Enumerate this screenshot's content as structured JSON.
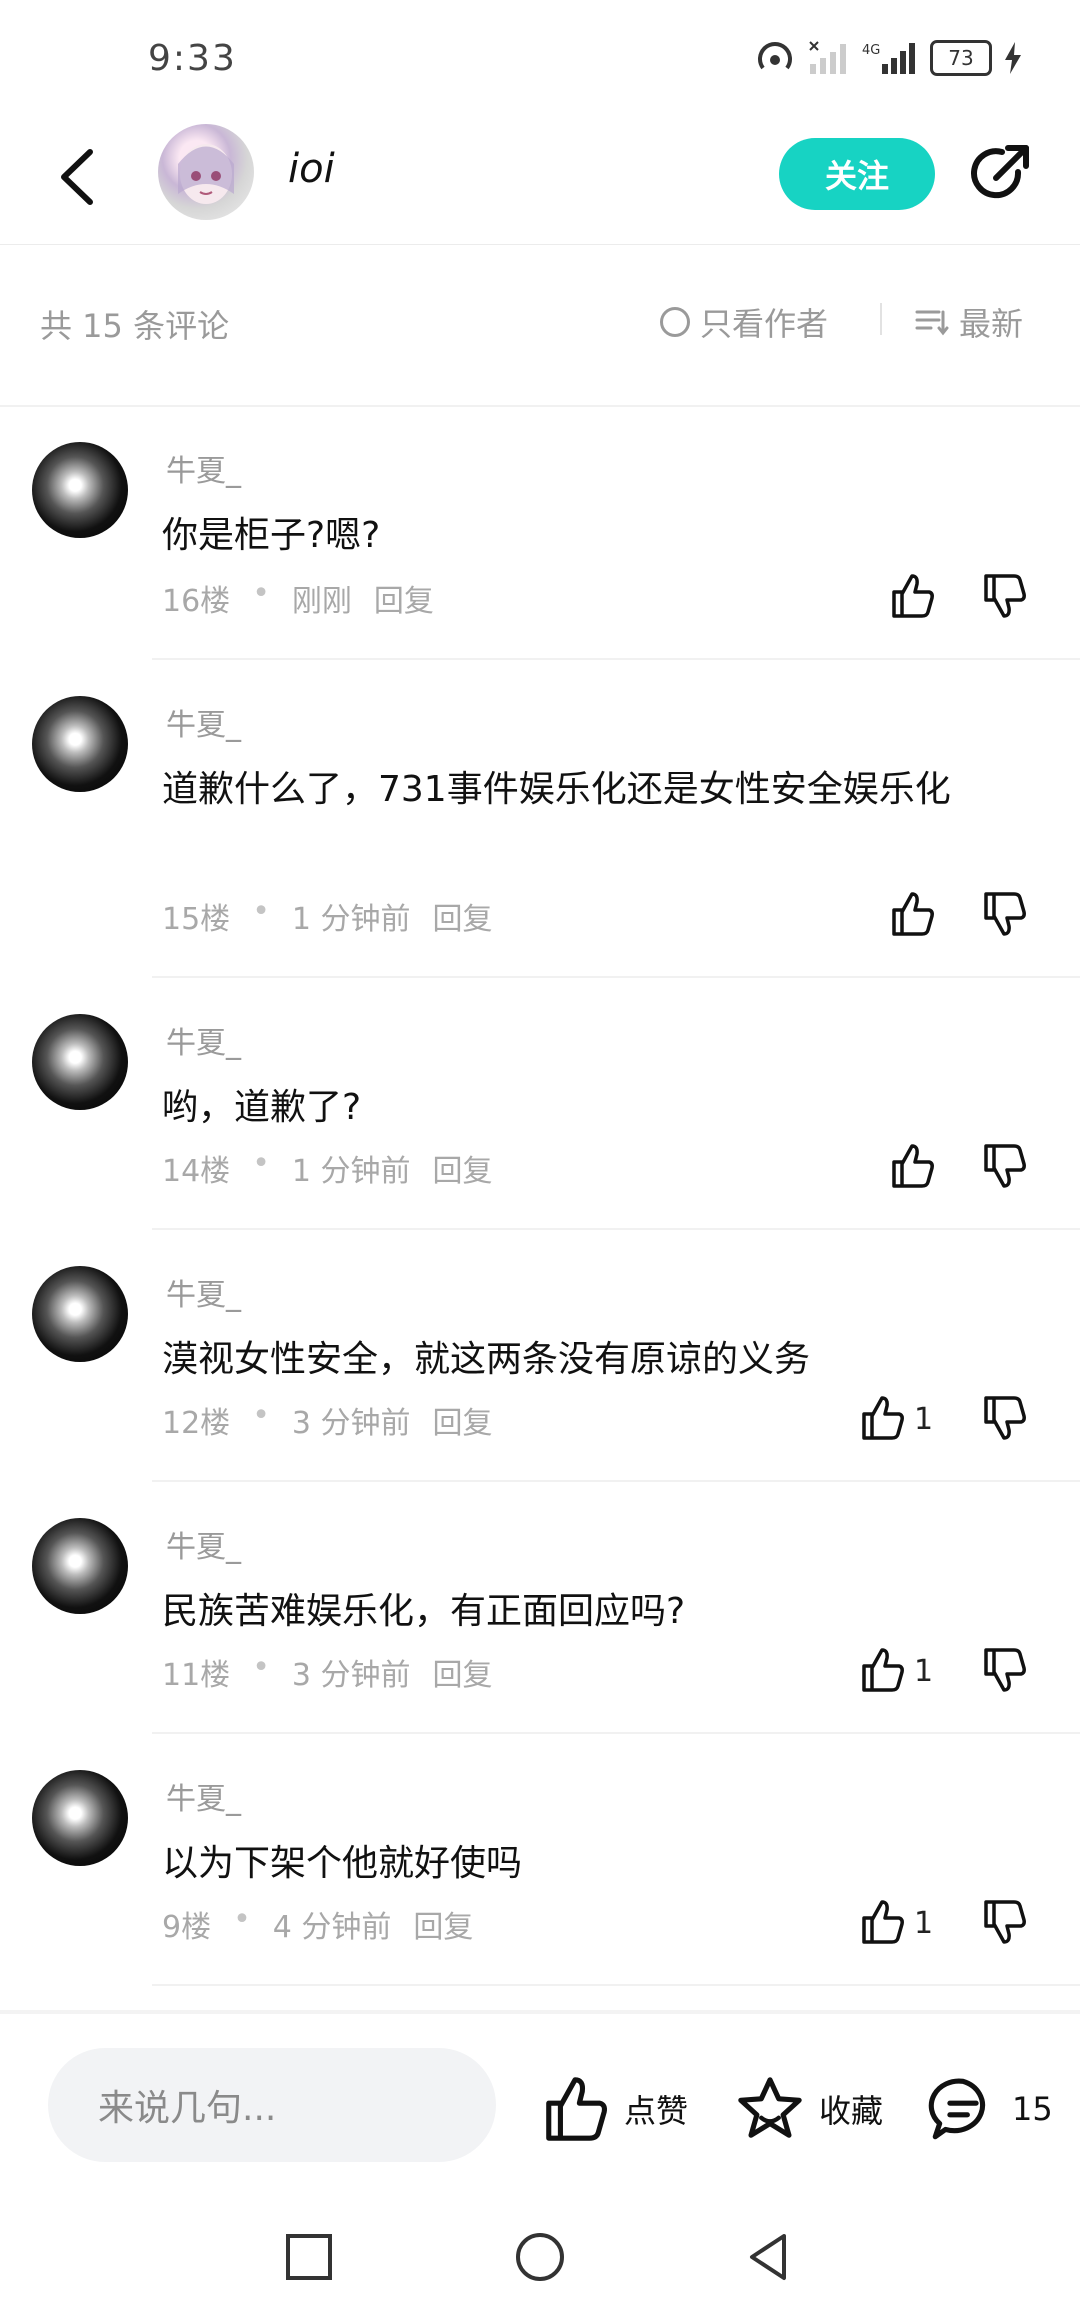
{
  "status_bar": {
    "time": "9:33",
    "battery": "73"
  },
  "header": {
    "username": "ioi",
    "follow_label": "关注"
  },
  "filter": {
    "comment_count": "共 15 条评论",
    "author_only": "只看作者",
    "sort_label": "最新"
  },
  "comments": [
    {
      "user": "牛夏_",
      "text": "你是柜子?嗯?",
      "floor": "16楼",
      "time": "刚刚",
      "reply": "回复",
      "likes": ""
    },
    {
      "user": "牛夏_",
      "text": "道歉什么了，731事件娱乐化还是女性安全娱乐化",
      "floor": "15楼",
      "time": "1 分钟前",
      "reply": "回复",
      "likes": ""
    },
    {
      "user": "牛夏_",
      "text": "哟，道歉了?",
      "floor": "14楼",
      "time": "1 分钟前",
      "reply": "回复",
      "likes": ""
    },
    {
      "user": "牛夏_",
      "text": "漠视女性安全，就这两条没有原谅的义务",
      "floor": "12楼",
      "time": "3 分钟前",
      "reply": "回复",
      "likes": "1"
    },
    {
      "user": "牛夏_",
      "text": "民族苦难娱乐化，有正面回应吗?",
      "floor": "11楼",
      "time": "3 分钟前",
      "reply": "回复",
      "likes": "1"
    },
    {
      "user": "牛夏_",
      "text": "以为下架个他就好使吗",
      "floor": "9楼",
      "time": "4 分钟前",
      "reply": "回复",
      "likes": "1"
    }
  ],
  "bottom_bar": {
    "input_placeholder": "来说几句...",
    "like_label": "点赞",
    "fav_label": "收藏",
    "comment_count": "15"
  }
}
